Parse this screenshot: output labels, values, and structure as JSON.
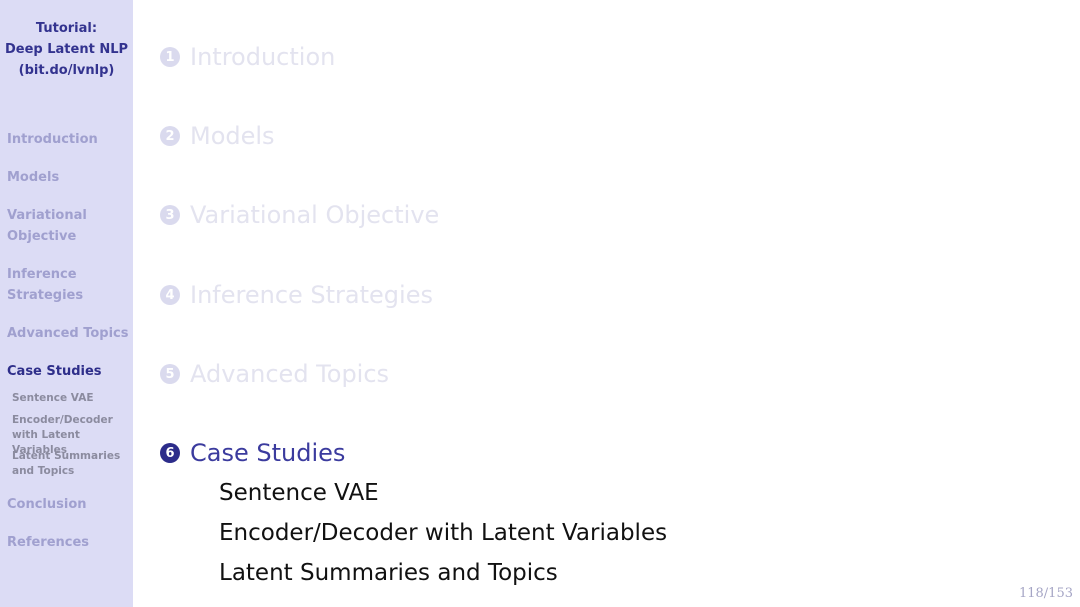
{
  "sidebar": {
    "title_lines": [
      "Tutorial:",
      "Deep Latent NLP",
      "(bit.do/lvnlp)"
    ],
    "sections": [
      {
        "label": "Introduction"
      },
      {
        "label": "Models"
      },
      {
        "label": "Variational Objective"
      },
      {
        "label": "Inference Strategies"
      },
      {
        "label": "Advanced Topics"
      },
      {
        "label": "Case Studies",
        "active": true
      },
      {
        "label": "Conclusion"
      },
      {
        "label": "References"
      }
    ],
    "subsections": [
      {
        "label": "Sentence VAE"
      },
      {
        "label": "Encoder/Decoder with Latent Variables"
      },
      {
        "label": "Latent Summaries and Topics"
      }
    ]
  },
  "toc": {
    "items": [
      {
        "number": "1",
        "label": "Introduction"
      },
      {
        "number": "2",
        "label": "Models"
      },
      {
        "number": "3",
        "label": "Variational Objective"
      },
      {
        "number": "4",
        "label": "Inference Strategies"
      },
      {
        "number": "5",
        "label": "Advanced Topics"
      },
      {
        "number": "6",
        "label": "Case Studies",
        "active": true
      }
    ],
    "subitems": [
      {
        "label": "Sentence VAE"
      },
      {
        "label": "Encoder/Decoder with Latent Variables"
      },
      {
        "label": "Latent Summaries and Topics"
      }
    ]
  },
  "footer": {
    "page_number": "118/153"
  }
}
